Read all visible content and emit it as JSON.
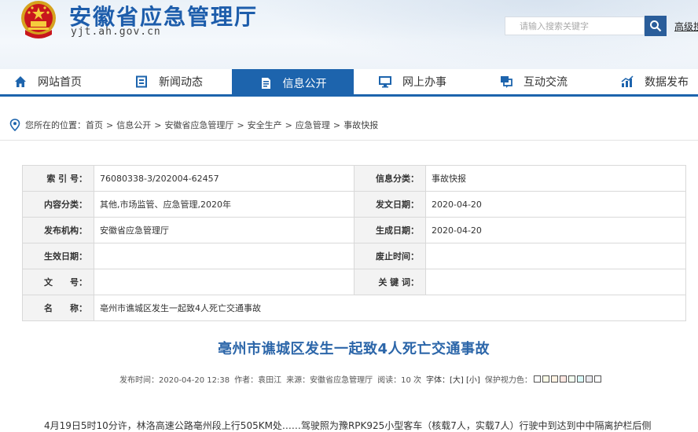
{
  "header": {
    "title": "安徽省应急管理厅",
    "url": "yjt.ah.gov.cn",
    "search_placeholder": "请输入搜索关键字",
    "advanced_search": "高级搜",
    "emblem_icon": "national-emblem-icon",
    "accent_color": "#1d64ad"
  },
  "nav": {
    "items": [
      {
        "label": "网站首页",
        "icon": "home-icon"
      },
      {
        "label": "新闻动态",
        "icon": "news-icon"
      },
      {
        "label": "信息公开",
        "icon": "document-icon",
        "active": true
      },
      {
        "label": "网上办事",
        "icon": "monitor-icon"
      },
      {
        "label": "互动交流",
        "icon": "chat-icon"
      },
      {
        "label": "数据发布",
        "icon": "chart-icon"
      }
    ]
  },
  "breadcrumb": {
    "prefix": "您所在的位置：",
    "items": [
      "首页",
      "信息公开",
      "安徽省应急管理厅",
      "安全生产",
      "应急管理",
      "事故快报"
    ],
    "separator": ">"
  },
  "info": {
    "index_label": "索 引 号：",
    "index_value": "76080338-3/202004-62457",
    "category_label": "信息分类：",
    "category_value": "事故快报",
    "topic_label": "内容分类：",
    "topic_value": "其他,市场监管、应急管理,2020年",
    "issued_label": "发文日期：",
    "issued_value": "2020-04-20",
    "publisher_label": "发布机构：",
    "publisher_value": "安徽省应急管理厅",
    "generated_label": "生成日期：",
    "generated_value": "2020-04-20",
    "effective_label": "生效日期：",
    "effective_value": "",
    "abolish_label": "废止时间：",
    "abolish_value": "",
    "docno_label": "文　　号：",
    "docno_value": "",
    "keywords_label": "关 键 词：",
    "keywords_value": "",
    "name_label": "名　　称：",
    "name_value": "亳州市谯城区发生一起致4人死亡交通事故"
  },
  "article": {
    "title": "亳州市谯城区发生一起致4人死亡交通事故",
    "publish_time": "发布时间：2020-04-20 12:38",
    "author": "作者：袁田江",
    "source": "来源：安徽省应急管理厅",
    "views": "阅读：10 次",
    "font_size": "字体：[大] [小]",
    "eye_protection": "保护视力色：",
    "eye_colors": [
      "#ffffff",
      "#fafbe6",
      "#fff2e2",
      "#fde6e0",
      "#f3fff1",
      "#dafaf9",
      "#eaeaef",
      "#ffffff"
    ],
    "first_line": "4月19日5时10分许，林洛高速公路亳州段上行505KM处……驾驶照为豫RPK925小型客车（核载7人，实载7人）行驶中到达到中中隔离护栏后侧"
  }
}
